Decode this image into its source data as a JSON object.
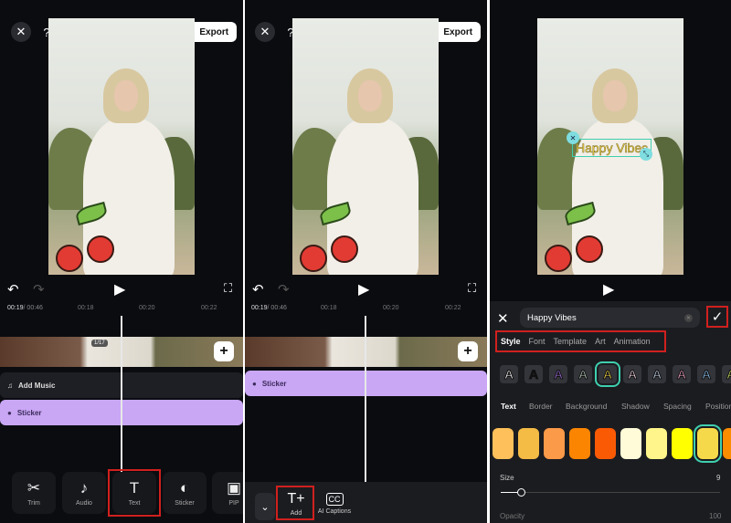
{
  "editor": {
    "export_label": "Export",
    "time_current": "00:19",
    "time_total": " / 00:46",
    "ticks": [
      "00:18",
      "00:20",
      "00:22"
    ]
  },
  "panel1": {
    "tracks": {
      "music": "Add Music",
      "sticker": "Sticker"
    },
    "tools": [
      "Trim",
      "Audio",
      "Text",
      "Sticker",
      "PIP"
    ],
    "clip_badge": "1/17"
  },
  "panel2": {
    "tracks": {
      "sticker": "Sticker"
    },
    "tools": [
      "Add",
      "AI Captions"
    ]
  },
  "panel3": {
    "overlay_text": "Happy Vibes",
    "input_value": "Happy Vibes",
    "tabs": [
      "Style",
      "Font",
      "Template",
      "Art",
      "Animation"
    ],
    "sub_tabs": [
      "Text",
      "Border",
      "Background",
      "Shadow",
      "Spacing",
      "Position"
    ],
    "size_label": "Size",
    "size_value": "9",
    "opacity_label": "Opacity",
    "opacity_value": "100",
    "size_fraction": 0.09,
    "swatches": [
      "#fdc05a",
      "#f4bb45",
      "#fb9a48",
      "#fb8500",
      "#fb5a05",
      "#fffbd8",
      "#fff58a",
      "#ffff00",
      "#f6d94a",
      "#fb8c00"
    ],
    "selected_swatch": 8,
    "selected_style": 4
  },
  "colors": {
    "sticker_track": "#c9a7f5",
    "highlight": "#d0201e",
    "selection": "#3ecfae"
  }
}
